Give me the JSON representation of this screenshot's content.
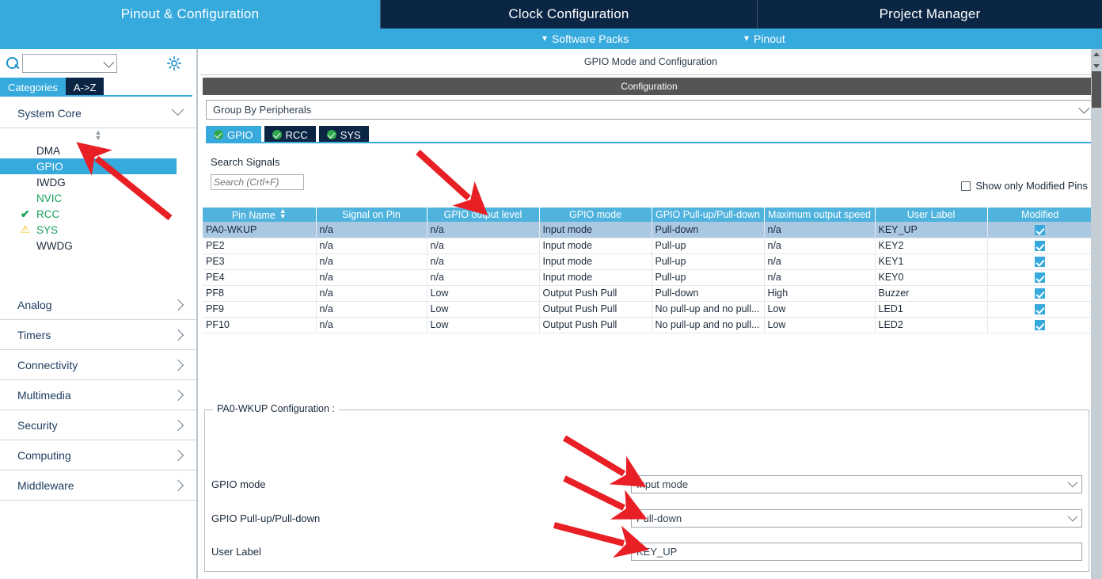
{
  "top_tabs": [
    {
      "label": "Pinout & Configuration",
      "active": true
    },
    {
      "label": "Clock Configuration",
      "active": false
    },
    {
      "label": "Project Manager",
      "active": false
    }
  ],
  "sub_bar": [
    {
      "label": "Software Packs",
      "icon": "chevron-down-icon"
    },
    {
      "label": "Pinout",
      "icon": "chevron-down-icon"
    }
  ],
  "sidebar": {
    "search_value": "",
    "search_placeholder": "",
    "gear_icon": "gear-icon",
    "tabs": [
      {
        "label": "Categories",
        "active": true
      },
      {
        "label": "A->Z",
        "active": false
      }
    ],
    "groups": [
      {
        "label": "System Core",
        "expanded": true,
        "icon": "chevron-down-icon"
      },
      {
        "label": "Analog",
        "expanded": false,
        "icon": "chevron-right-icon"
      },
      {
        "label": "Timers",
        "expanded": false,
        "icon": "chevron-right-icon"
      },
      {
        "label": "Connectivity",
        "expanded": false,
        "icon": "chevron-right-icon"
      },
      {
        "label": "Multimedia",
        "expanded": false,
        "icon": "chevron-right-icon"
      },
      {
        "label": "Security",
        "expanded": false,
        "icon": "chevron-right-icon"
      },
      {
        "label": "Computing",
        "expanded": false,
        "icon": "chevron-right-icon"
      },
      {
        "label": "Middleware",
        "expanded": false,
        "icon": "chevron-right-icon"
      }
    ],
    "system_core_items": [
      {
        "label": "DMA",
        "state": "none",
        "selected": false,
        "mark": ""
      },
      {
        "label": "GPIO",
        "state": "none",
        "selected": true,
        "mark": ""
      },
      {
        "label": "IWDG",
        "state": "none",
        "selected": false,
        "mark": ""
      },
      {
        "label": "NVIC",
        "state": "green",
        "selected": false,
        "mark": ""
      },
      {
        "label": "RCC",
        "state": "green",
        "selected": false,
        "mark": "check"
      },
      {
        "label": "SYS",
        "state": "green",
        "selected": false,
        "mark": "warn"
      },
      {
        "label": "WWDG",
        "state": "none",
        "selected": false,
        "mark": ""
      }
    ]
  },
  "main": {
    "mode_header": "GPIO Mode and Configuration",
    "configuration_header": "Configuration",
    "group_by": "Group By Peripherals",
    "peripheral_tabs": [
      {
        "label": "GPIO",
        "active": true,
        "icon": "check-circle-icon"
      },
      {
        "label": "RCC",
        "active": false,
        "icon": "check-circle-icon"
      },
      {
        "label": "SYS",
        "active": false,
        "icon": "check-circle-icon"
      }
    ],
    "search_signals_label": "Search Signals",
    "search_signals_value": "",
    "search_signals_placeholder": "Search (Crtl+F)",
    "show_only_modified": {
      "label": "Show only Modified Pins",
      "checked": false
    },
    "table": {
      "columns": [
        "Pin Name",
        "Signal on Pin",
        "GPIO output level",
        "GPIO mode",
        "GPIO Pull-up/Pull-down",
        "Maximum output speed",
        "User Label",
        "Modified"
      ],
      "sort_column": "Pin Name",
      "sort_icon": "sort-arrows-icon",
      "rows": [
        {
          "pin_name": "PA0-WKUP",
          "signal_on_pin": "n/a",
          "output_level": "n/a",
          "gpio_mode": "Input mode",
          "pull": "Pull-down",
          "max_speed": "n/a",
          "user_label": "KEY_UP",
          "modified": true,
          "selected": true
        },
        {
          "pin_name": "PE2",
          "signal_on_pin": "n/a",
          "output_level": "n/a",
          "gpio_mode": "Input mode",
          "pull": "Pull-up",
          "max_speed": "n/a",
          "user_label": "KEY2",
          "modified": true,
          "selected": false
        },
        {
          "pin_name": "PE3",
          "signal_on_pin": "n/a",
          "output_level": "n/a",
          "gpio_mode": "Input mode",
          "pull": "Pull-up",
          "max_speed": "n/a",
          "user_label": "KEY1",
          "modified": true,
          "selected": false
        },
        {
          "pin_name": "PE4",
          "signal_on_pin": "n/a",
          "output_level": "n/a",
          "gpio_mode": "Input mode",
          "pull": "Pull-up",
          "max_speed": "n/a",
          "user_label": "KEY0",
          "modified": true,
          "selected": false
        },
        {
          "pin_name": "PF8",
          "signal_on_pin": "n/a",
          "output_level": "Low",
          "gpio_mode": "Output Push Pull",
          "pull": "Pull-down",
          "max_speed": "High",
          "user_label": "Buzzer",
          "modified": true,
          "selected": false
        },
        {
          "pin_name": "PF9",
          "signal_on_pin": "n/a",
          "output_level": "Low",
          "gpio_mode": "Output Push Pull",
          "pull": "No pull-up and no pull...",
          "max_speed": "Low",
          "user_label": "LED1",
          "modified": true,
          "selected": false
        },
        {
          "pin_name": "PF10",
          "signal_on_pin": "n/a",
          "output_level": "Low",
          "gpio_mode": "Output Push Pull",
          "pull": "No pull-up and no pull...",
          "max_speed": "Low",
          "user_label": "LED2",
          "modified": true,
          "selected": false
        }
      ]
    },
    "pin_config": {
      "legend": "PA0-WKUP Configuration :",
      "fields": [
        {
          "label": "GPIO mode",
          "value": "Input mode",
          "type": "dropdown"
        },
        {
          "label": "GPIO Pull-up/Pull-down",
          "value": "Pull-down",
          "type": "dropdown"
        },
        {
          "label": "User Label",
          "value": "KEY_UP",
          "type": "text"
        }
      ]
    }
  },
  "colors": {
    "accent_blue": "#36a9dd",
    "dark_navy": "#0b2545",
    "header_blue": "#4fb3de",
    "row_selected": "#abc8e2",
    "config_header_gray": "#555555",
    "annotation_red": "#e81f24",
    "green_ok": "#2fa84f",
    "warn_yellow": "#f0c000"
  }
}
